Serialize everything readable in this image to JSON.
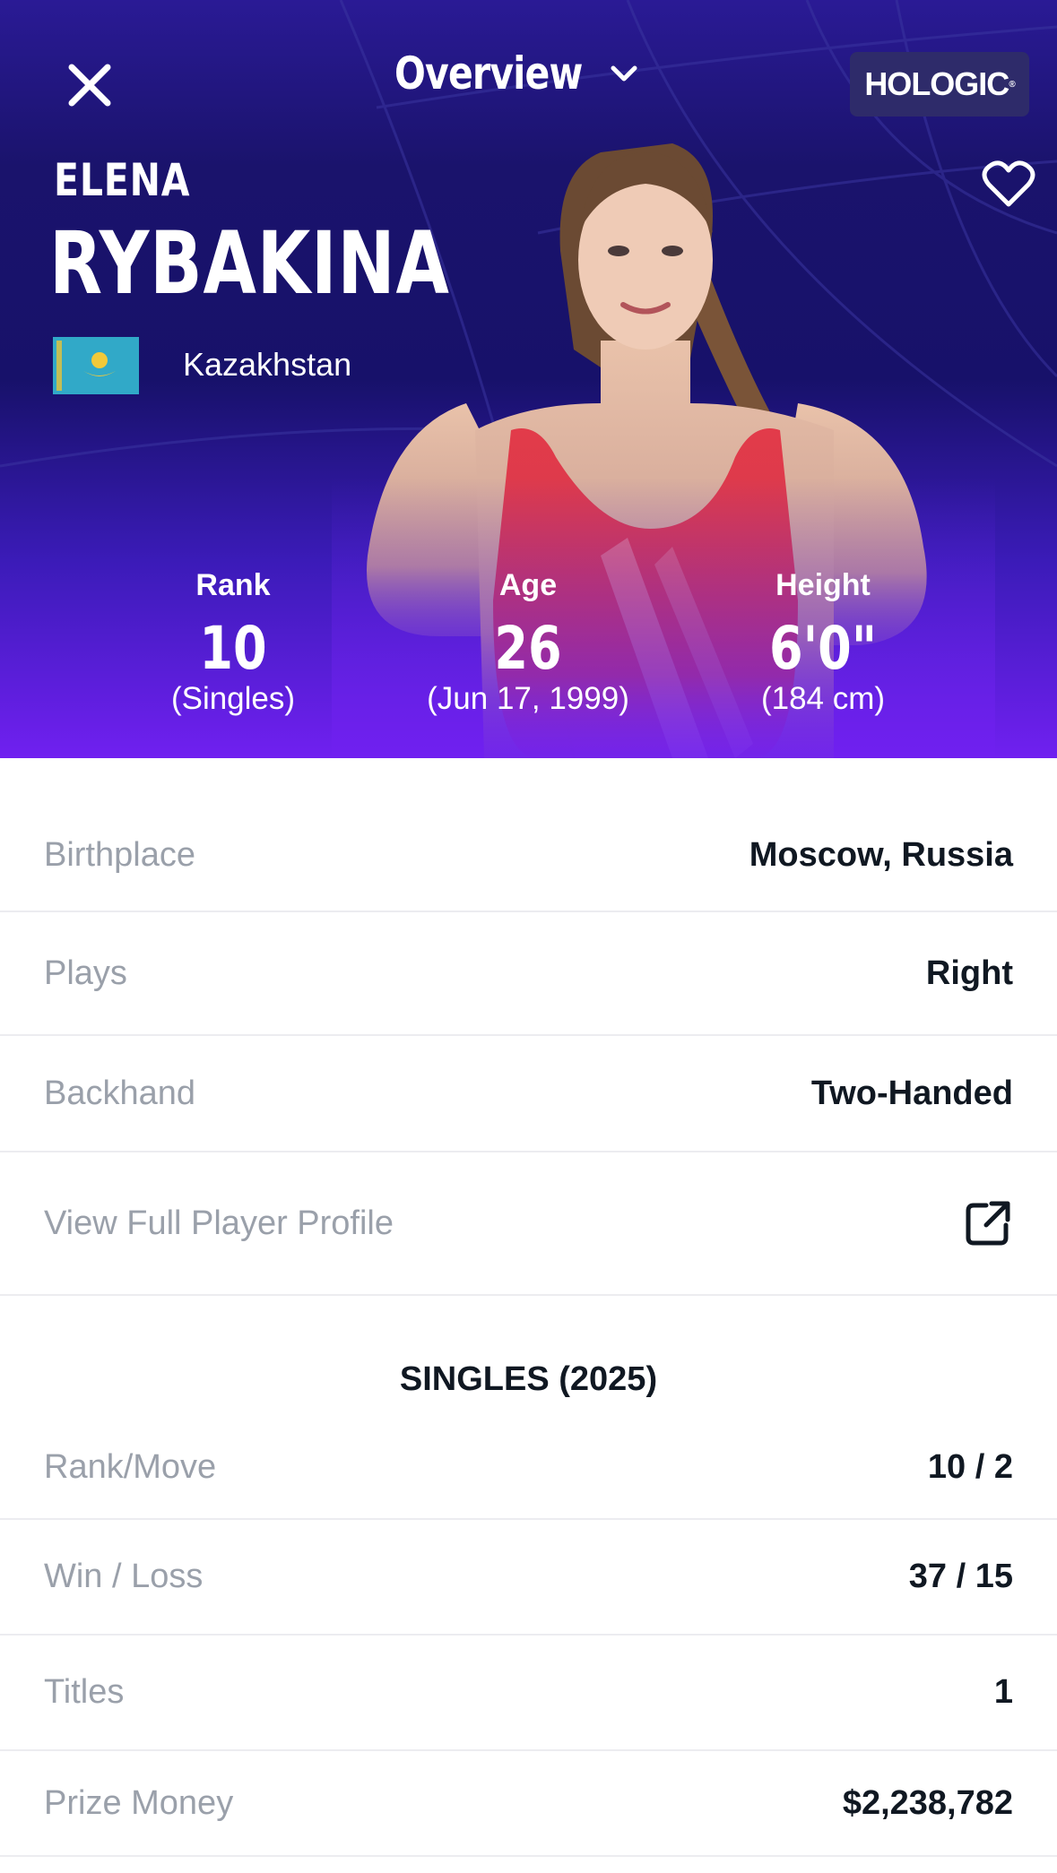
{
  "header": {
    "title": "Overview",
    "sponsor": "HOLOGIC"
  },
  "player": {
    "first_name": "ELENA",
    "last_name": "RYBAKINA",
    "country": "Kazakhstan"
  },
  "stats": [
    {
      "label": "Rank",
      "value": "10",
      "sub": "(Singles)"
    },
    {
      "label": "Age",
      "value": "26",
      "sub": "(Jun 17, 1999)"
    },
    {
      "label": "Height",
      "value": "6'0\"",
      "sub": "(184 cm)"
    }
  ],
  "bio": [
    {
      "key": "Birthplace",
      "value": "Moscow, Russia"
    },
    {
      "key": "Plays",
      "value": "Right"
    },
    {
      "key": "Backhand",
      "value": "Two-Handed"
    }
  ],
  "profile_link": "View Full Player Profile",
  "singles": {
    "title": "SINGLES (2025)",
    "rows": [
      {
        "key": "Rank/Move",
        "value": "10 / 2"
      },
      {
        "key": "Win / Loss",
        "value": "37 / 15"
      },
      {
        "key": "Titles",
        "value": "1"
      },
      {
        "key": "Prize Money",
        "value": "$2,238,782"
      }
    ]
  },
  "colors": {
    "hero_top": "#1a136c",
    "hero_bottom": "#7020f0",
    "flag": "#31a9c8",
    "text_dark": "#101822",
    "text_muted": "#9aa0aa"
  },
  "icons": [
    "close-icon",
    "chevron-down-icon",
    "heart-icon",
    "external-link-icon"
  ]
}
